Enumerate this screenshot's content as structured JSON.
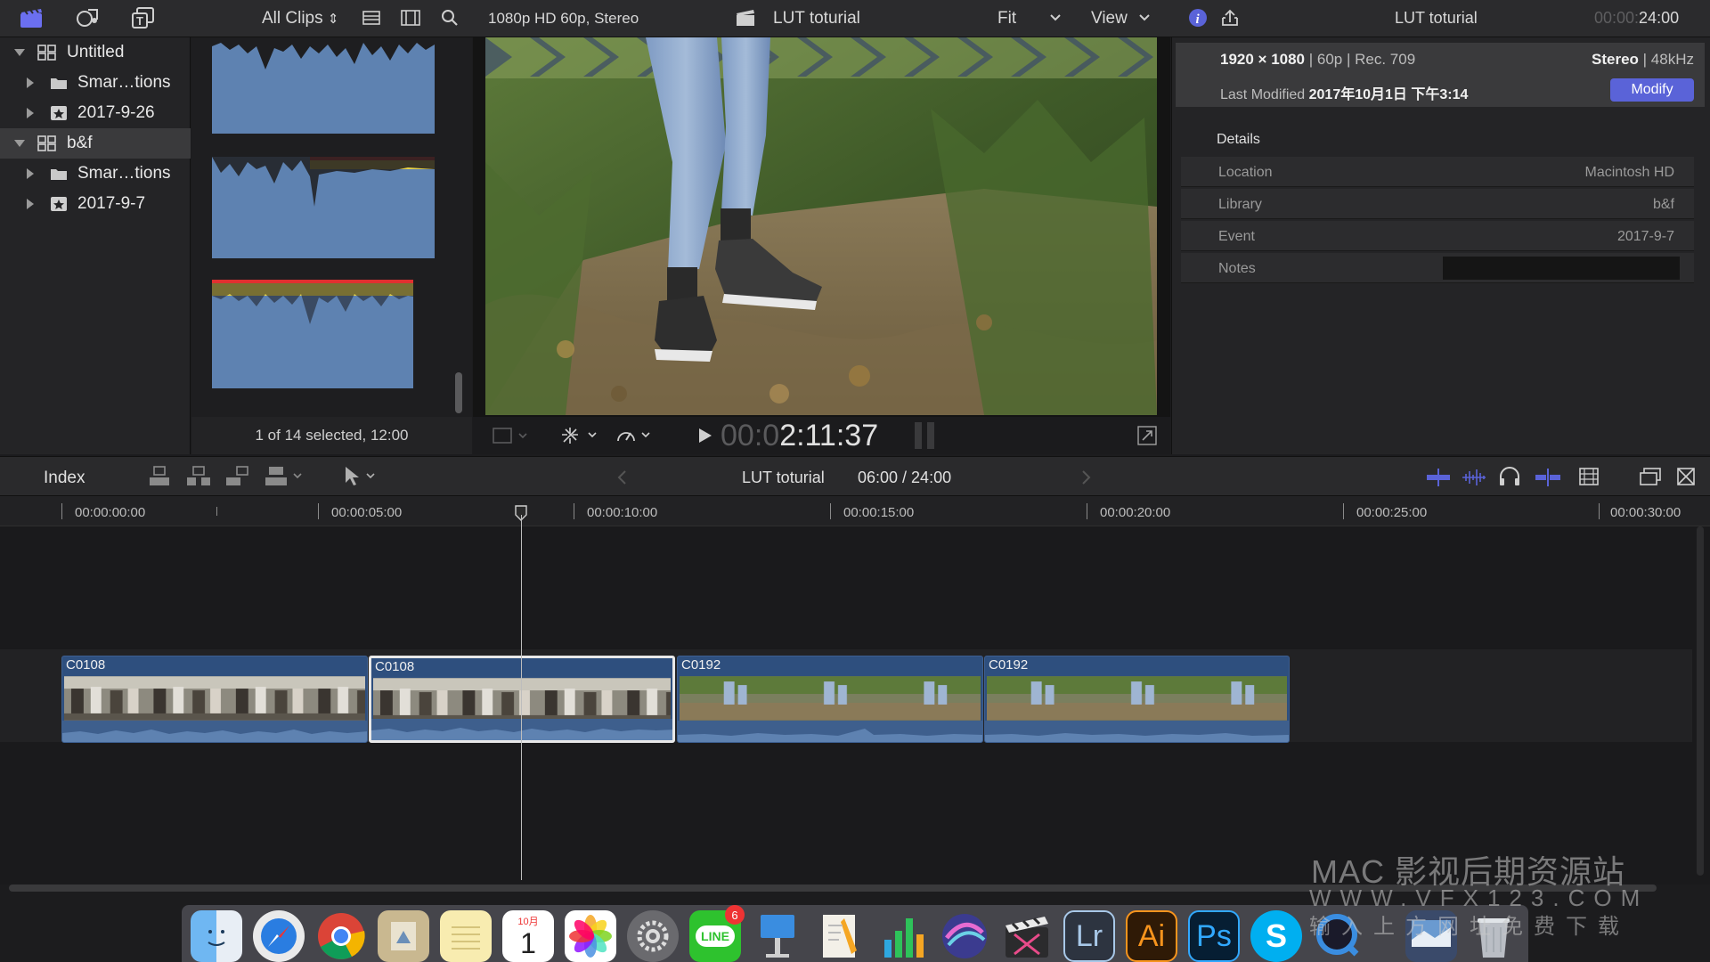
{
  "toolbar": {
    "clips_filter": "All Clips",
    "clips_filter_chevron": "⇕",
    "viewer_format": "1080p HD 60p, Stereo",
    "viewer_title": "LUT toturial",
    "fit_label": "Fit",
    "view_label": "View",
    "inspector_title": "LUT toturial",
    "inspector_time_dim": "00:00:",
    "inspector_time": "24:00",
    "icons": [
      "libraries-icon",
      "photos-audio-icon",
      "titles-generators-icon",
      "list-view-icon",
      "filmstrip-view-icon",
      "search-icon",
      "clapper-icon",
      "info-icon",
      "share-icon"
    ]
  },
  "library": {
    "items": [
      {
        "label": "Untitled",
        "icon": "library-icon",
        "expanded": true
      },
      {
        "label": "Smar…tions",
        "icon": "folder-icon"
      },
      {
        "label": "2017-9-26",
        "icon": "event-icon"
      },
      {
        "label": "b&f",
        "icon": "library-icon",
        "expanded": true,
        "selected": true
      },
      {
        "label": "Smar…tions",
        "icon": "folder-icon"
      },
      {
        "label": "2017-9-7",
        "icon": "event-icon"
      }
    ]
  },
  "browser": {
    "status": "1 of 14 selected, 12:00"
  },
  "viewer": {
    "timecode_dim": "00:0",
    "timecode": "2:11:37"
  },
  "inspector": {
    "resolution": "1920 × 1080",
    "specs": "| 60p | Rec. 709",
    "audio_bold": "Stereo",
    "audio_rate": "| 48kHz",
    "last_modified_label": "Last Modified",
    "last_modified_value": "2017年10月1日 下午3:14",
    "modify_button": "Modify",
    "details_header": "Details",
    "rows": [
      {
        "label": "Location",
        "value": "Macintosh HD"
      },
      {
        "label": "Library",
        "value": "b&f"
      },
      {
        "label": "Event",
        "value": "2017-9-7"
      },
      {
        "label": "Notes",
        "value": ""
      }
    ]
  },
  "timeline": {
    "index_label": "Index",
    "project_name": "LUT toturial",
    "project_time": "06:00 / 24:00",
    "ruler": [
      "00:00:00:00",
      "00:00:05:00",
      "00:00:10:00",
      "00:00:15:00",
      "00:00:20:00",
      "00:00:25:00",
      "00:00:30:00"
    ],
    "clips": [
      {
        "name": "C0108",
        "selected": false
      },
      {
        "name": "C0108",
        "selected": true
      },
      {
        "name": "C0192",
        "selected": false
      },
      {
        "name": "C0192",
        "selected": false
      }
    ]
  },
  "dock": {
    "apps": [
      "finder-icon",
      "safari-icon",
      "chrome-icon",
      "preview-icon",
      "notes-icon",
      "calendar-icon",
      "photos-icon",
      "system-preferences-icon",
      "line-icon",
      "keynote-icon",
      "pages-icon",
      "numbers-icon",
      "motion-icon",
      "final-cut-icon",
      "lightroom-icon",
      "illustrator-icon",
      "photoshop-icon",
      "skype-icon",
      "quicktime-icon",
      "screen-icon",
      "trash-icon"
    ],
    "calendar_month": "10月",
    "calendar_day": "1",
    "line_label": "LINE",
    "line_badge": "6",
    "lr_label": "Lr",
    "ai_label": "Ai",
    "ps_label": "Ps",
    "skype_label": "S"
  },
  "watermark": {
    "line1": "MAC 影视后期资源站",
    "line2": "WWW.VFX123.COM",
    "line3": "输入上方网址免费下载"
  },
  "colors": {
    "accent": "#5a63d8",
    "clip": "#2e4f7e",
    "waveform": "#5e82b1"
  }
}
